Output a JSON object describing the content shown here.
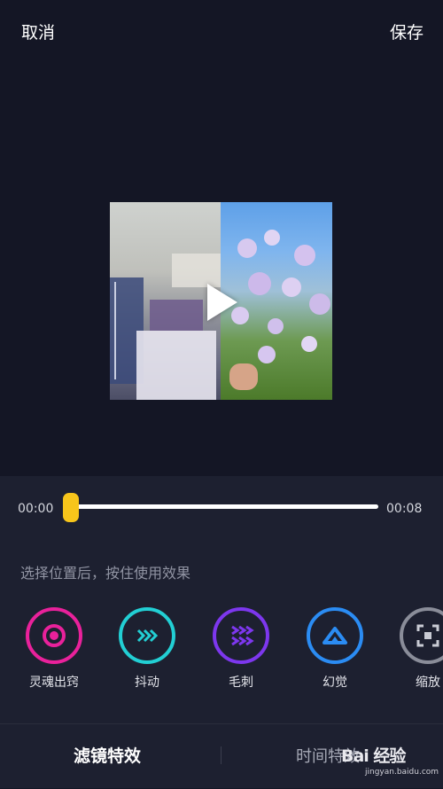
{
  "header": {
    "cancel_label": "取消",
    "save_label": "保存"
  },
  "player": {
    "time_start": "00:00",
    "time_end": "00:08",
    "progress": 0
  },
  "hint": "选择位置后，按住使用效果",
  "effects": [
    {
      "label": "灵魂出窍",
      "color": "#e9219b",
      "icon": "soul-icon"
    },
    {
      "label": "抖动",
      "color": "#22cfd4",
      "icon": "shake-icon"
    },
    {
      "label": "毛刺",
      "color": "#7d37ee",
      "icon": "glitch-icon"
    },
    {
      "label": "幻觉",
      "color": "#2b8cf3",
      "icon": "illusion-icon"
    },
    {
      "label": "缩放",
      "color": "#8a8d99",
      "icon": "zoom-icon"
    }
  ],
  "tabs": {
    "filter_label": "滤镜特效",
    "time_label": "时间特效"
  },
  "watermark": {
    "text": "Bai 经验",
    "url": "jingyan.baidu.com"
  },
  "colors": {
    "accent": "#f7c51b",
    "background": "#141625",
    "panel": "#1d2030"
  }
}
